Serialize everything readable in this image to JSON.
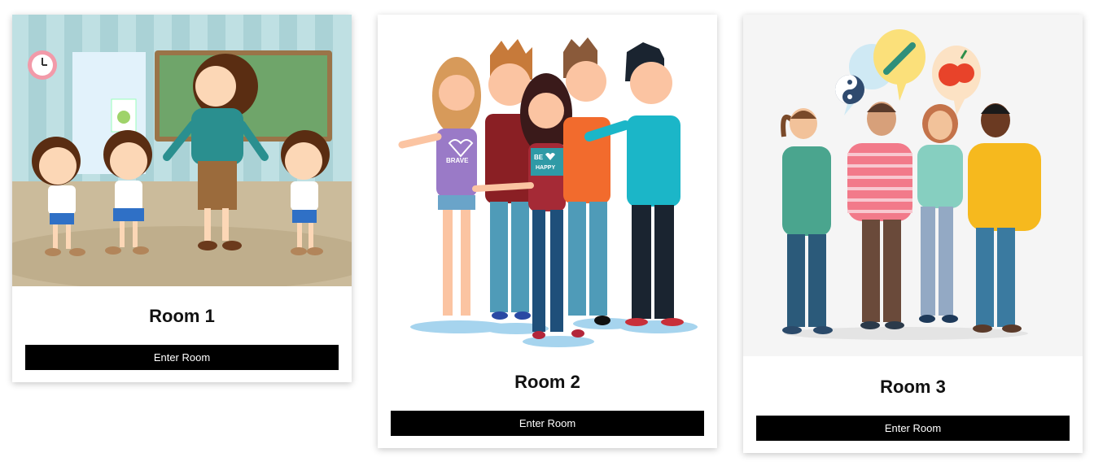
{
  "rooms": [
    {
      "title": "Room 1",
      "button_label": "Enter Room",
      "illustration": "classroom-teacher-children",
      "shirt_text": ""
    },
    {
      "title": "Room 2",
      "button_label": "Enter Room",
      "illustration": "group-of-friends",
      "shirt_text": [
        "BRAVE",
        "BE",
        "HAPPY"
      ]
    },
    {
      "title": "Room 3",
      "button_label": "Enter Room",
      "illustration": "people-talking-wellness",
      "shirt_text": ""
    }
  ],
  "colors": {
    "button_bg": "#000000",
    "button_text": "#ffffff",
    "card_bg": "#ffffff",
    "title_text": "#111111"
  }
}
